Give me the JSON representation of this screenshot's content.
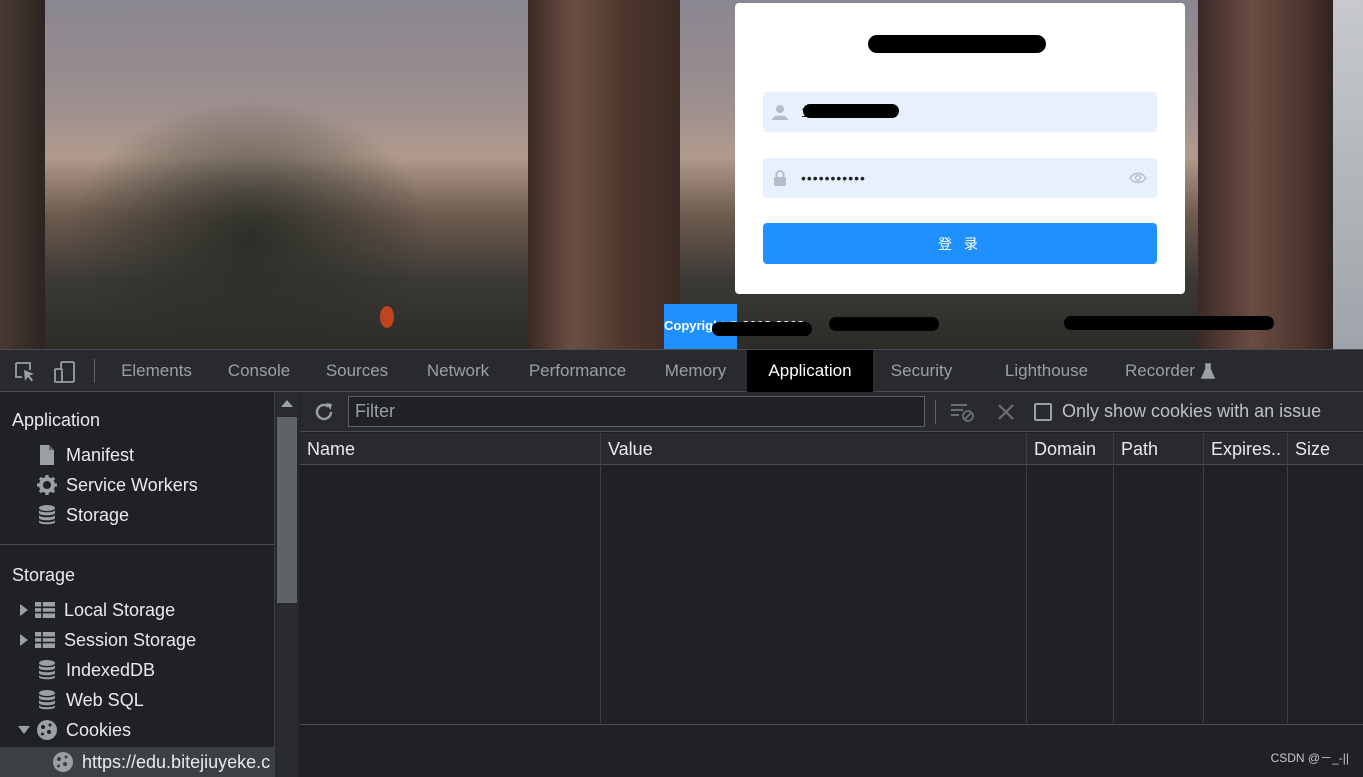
{
  "login": {
    "username_value": "15",
    "password_value": "•••••••••••",
    "login_button": "登 录",
    "copyright": "Copyright © 2018-2019"
  },
  "devtools": {
    "tabs": [
      "Elements",
      "Console",
      "Sources",
      "Network",
      "Performance",
      "Memory",
      "Application",
      "Security",
      "Lighthouse",
      "Recorder"
    ],
    "active_tab": "Application",
    "sidebar": {
      "application_header": "Application",
      "application_items": [
        {
          "label": "Manifest",
          "icon": "document-icon"
        },
        {
          "label": "Service Workers",
          "icon": "gear-icon"
        },
        {
          "label": "Storage",
          "icon": "database-icon"
        }
      ],
      "storage_header": "Storage",
      "storage_items": [
        {
          "label": "Local Storage",
          "icon": "table-grid-icon",
          "expandable": true
        },
        {
          "label": "Session Storage",
          "icon": "table-grid-icon",
          "expandable": true
        },
        {
          "label": "IndexedDB",
          "icon": "database-icon",
          "expandable": false
        },
        {
          "label": "Web SQL",
          "icon": "database-icon",
          "expandable": false
        },
        {
          "label": "Cookies",
          "icon": "cookie-icon",
          "expandable": true,
          "expanded": true
        }
      ],
      "cookie_url": "https://edu.bitejiuyeke.c"
    },
    "toolbar": {
      "filter_placeholder": "Filter",
      "only_issue_label": "Only show cookies with an issue"
    },
    "table": {
      "columns": [
        "Name",
        "Value",
        "Domain",
        "Path",
        "Expires..",
        "Size"
      ]
    }
  },
  "watermark": "CSDN @－_-||",
  "colors": {
    "accent_blue": "#1e90ff",
    "devtools_bg": "#202124",
    "annotation_red": "#e0201b"
  }
}
